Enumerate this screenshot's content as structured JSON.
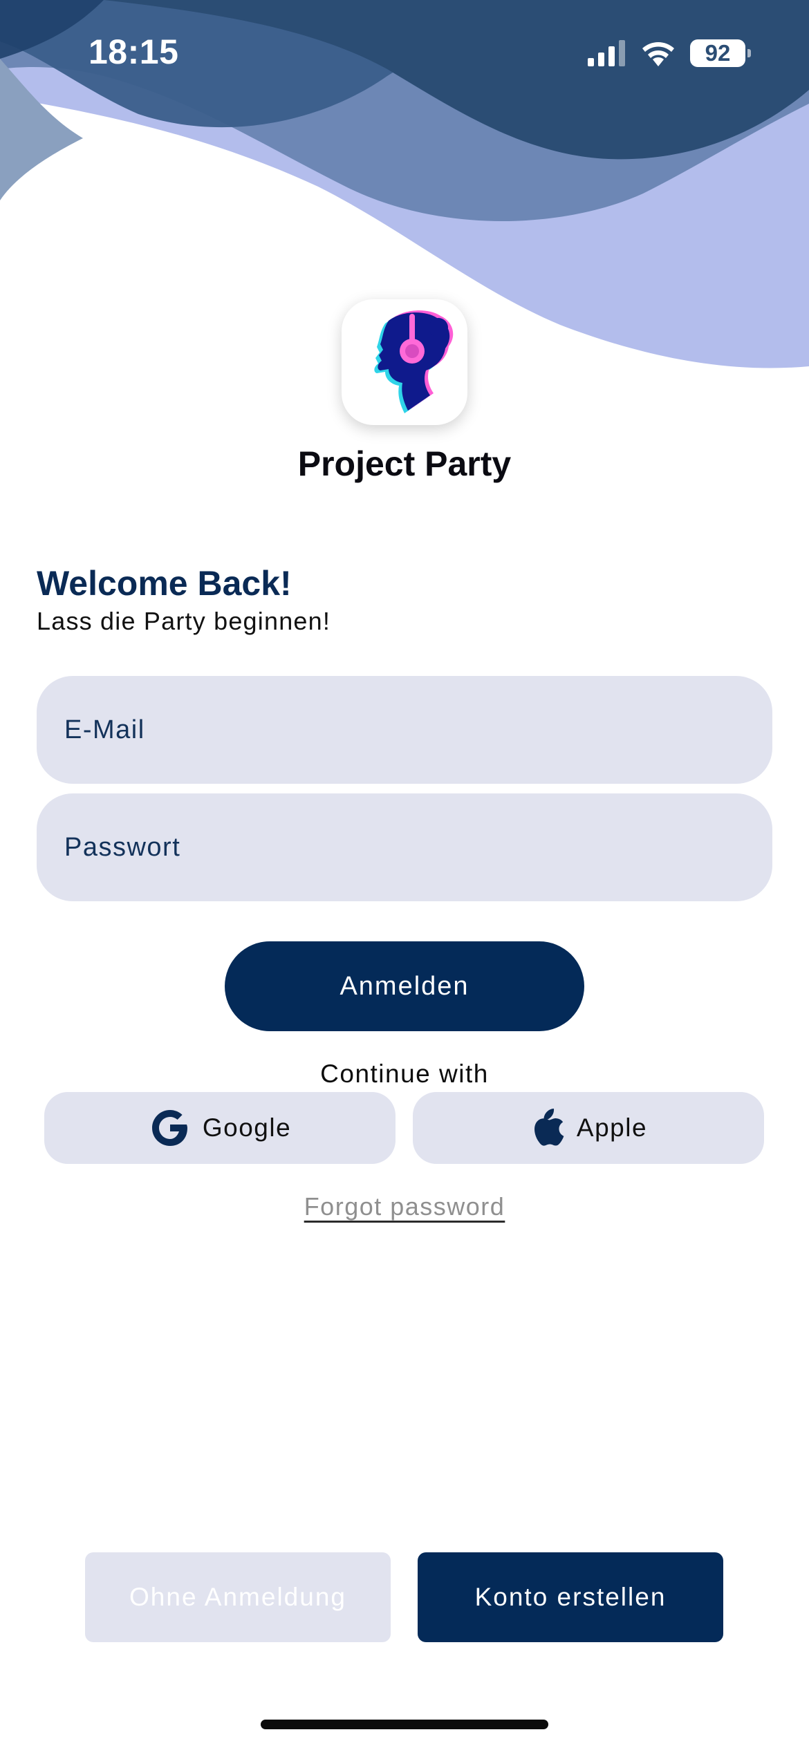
{
  "status_bar": {
    "time": "18:15",
    "battery": "92",
    "icons": [
      "signal-icon",
      "wifi-icon",
      "battery-icon"
    ]
  },
  "app": {
    "name": "Project Party",
    "logo_icon": "headphones-silhouette-logo"
  },
  "welcome": {
    "title": "Welcome Back!",
    "subtitle": "Lass die Party beginnen!"
  },
  "form": {
    "email_placeholder": "E-Mail",
    "password_placeholder": "Passwort",
    "login_label": "Anmelden"
  },
  "social": {
    "label": "Continue with",
    "google_label": "Google",
    "apple_label": "Apple"
  },
  "forgot_password": "Forgot password",
  "bottom_actions": {
    "guest_label": "Ohne Anmeldung",
    "register_label": "Konto erstellen"
  },
  "colors": {
    "primary": "#042a58",
    "field_background": "#e1e3ef",
    "wave_dark": "#2b4d74",
    "wave_light": "#b3bdec"
  }
}
